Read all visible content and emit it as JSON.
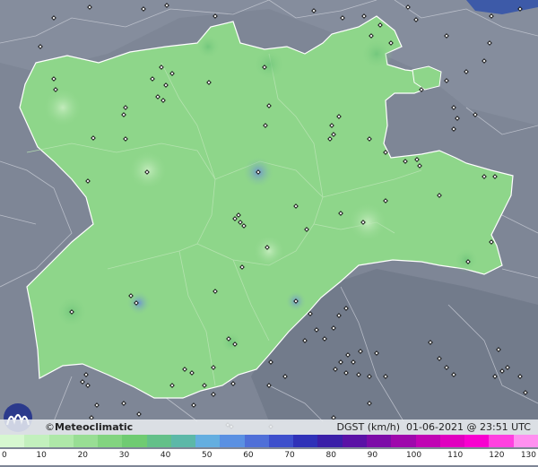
{
  "brand": {
    "name": "Meteoclimatic",
    "logo_icon": "meteoclimatic-m-logo-icon"
  },
  "map": {
    "variable": "DGST (km/h)",
    "date": "01-06-2021",
    "time_sep": "@",
    "time": "23:51 UTC",
    "region_fill": "#8ed68a",
    "outside_fill": "#7d8594",
    "station_marker": "diamond"
  },
  "legend": {
    "unit_values": [
      "0",
      "10",
      "20",
      "30",
      "40",
      "50",
      "60",
      "70",
      "80",
      "90",
      "100",
      "110",
      "120",
      "130"
    ],
    "colors": [
      "#d6f7d0",
      "#c2f0bd",
      "#aee8a8",
      "#98de94",
      "#82d480",
      "#6fcb72",
      "#63c089",
      "#5cb8a8",
      "#64aee0",
      "#5a90e2",
      "#4f6fd8",
      "#3d4fcc",
      "#2f31b8",
      "#3a1fa8",
      "#5a12a6",
      "#7c0ca8",
      "#9e08ac",
      "#c004b4",
      "#e000c0",
      "#f800d0",
      "#ff40e0",
      "#ff90f0"
    ]
  }
}
